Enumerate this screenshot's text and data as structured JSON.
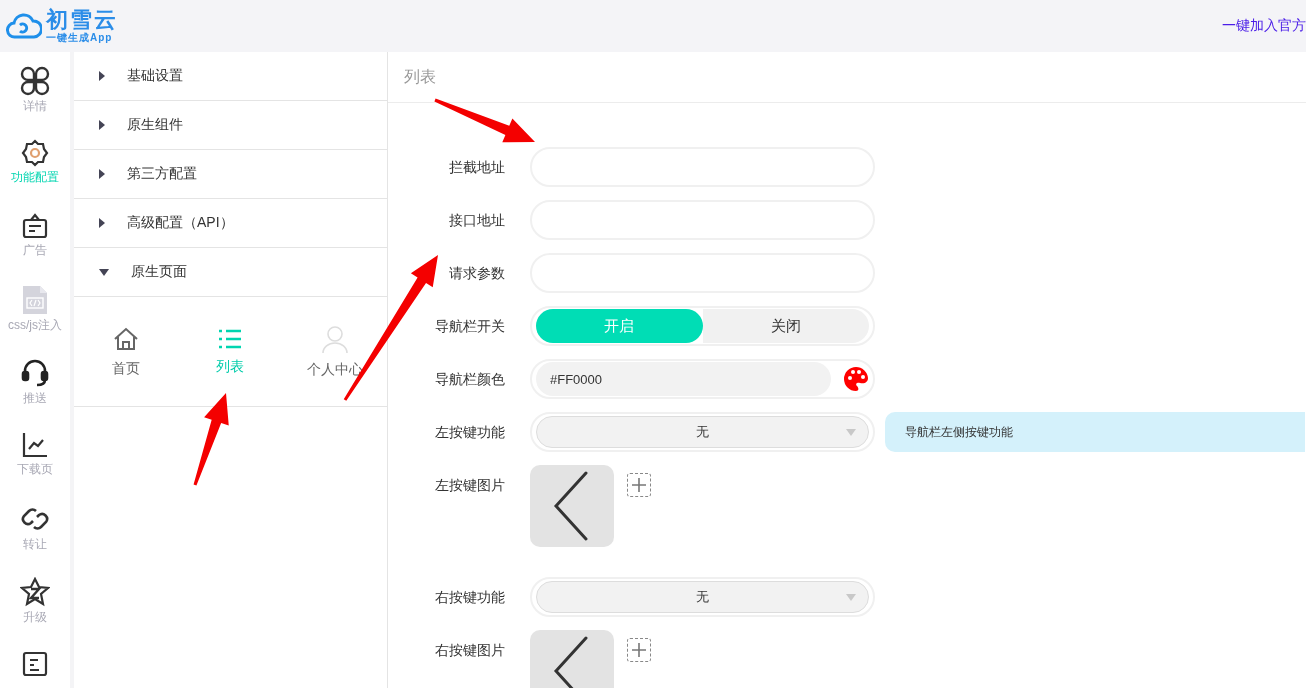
{
  "header": {
    "logo_title": "初雪云",
    "logo_subtitle": "一键生成App",
    "join_link": "一键加入官方"
  },
  "rail": [
    {
      "label": "详情",
      "selected": false
    },
    {
      "label": "功能配置",
      "selected": true
    },
    {
      "label": "广告",
      "selected": false
    },
    {
      "label": "css/js注入",
      "selected": false
    },
    {
      "label": "推送",
      "selected": false
    },
    {
      "label": "下载页",
      "selected": false
    },
    {
      "label": "转让",
      "selected": false
    },
    {
      "label": "升级",
      "selected": false
    },
    {
      "selected": false
    }
  ],
  "menu": [
    {
      "label": "基础设置",
      "expanded": false
    },
    {
      "label": "原生组件",
      "expanded": false
    },
    {
      "label": "第三方配置",
      "expanded": false
    },
    {
      "label": "高级配置（API）",
      "expanded": false
    },
    {
      "label": "原生页面",
      "expanded": true
    }
  ],
  "page_tabs": [
    {
      "label": "首页",
      "selected": false
    },
    {
      "label": "列表",
      "selected": true
    },
    {
      "label": "个人中心",
      "selected": false
    }
  ],
  "form": {
    "title": "列表",
    "rows": [
      {
        "kind": "text",
        "label": "拦截地址"
      },
      {
        "kind": "text",
        "label": "接口地址"
      },
      {
        "kind": "text",
        "label": "请求参数"
      },
      {
        "kind": "toggle",
        "label": "导航栏开关",
        "options": [
          {
            "label": "开启",
            "selected": true
          },
          {
            "label": "关闭",
            "selected": false
          }
        ]
      },
      {
        "kind": "color",
        "label": "导航栏颜色",
        "value": "#FF0000"
      },
      {
        "kind": "select",
        "label": "左按键功能",
        "value": "无",
        "tooltip": "导航栏左侧按键功能"
      },
      {
        "kind": "image",
        "label": "左按键图片"
      },
      {
        "kind": "select",
        "label": "右按键功能",
        "value": "无"
      },
      {
        "kind": "image",
        "label": "右按键图片"
      }
    ]
  }
}
